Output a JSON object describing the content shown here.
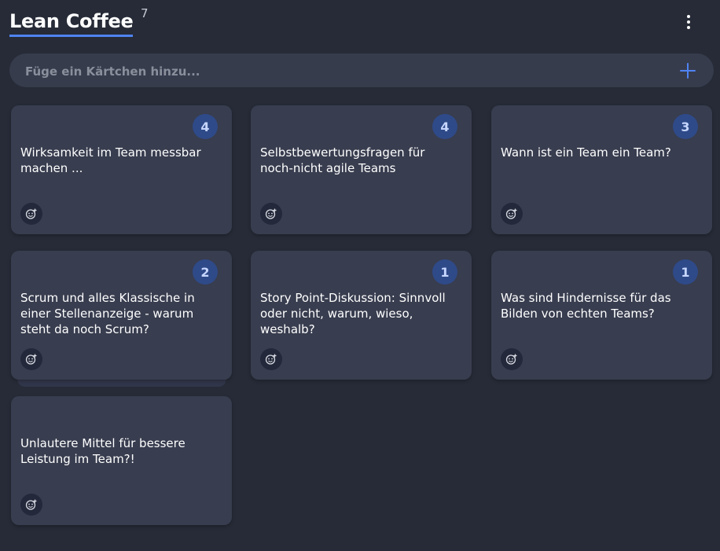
{
  "header": {
    "title": "Lean Coffee",
    "count": "7",
    "menu_icon": "more-vertical-icon"
  },
  "add_bar": {
    "placeholder": "Füge ein Kärtchen hinzu...",
    "value": "",
    "add_icon": "plus-icon",
    "accent": "#4f83f2"
  },
  "cards": [
    {
      "text": "Wirksamkeit im Team messbar machen ...",
      "votes": "4"
    },
    {
      "text": "Selbstbewertungsfragen für noch-nicht agile Teams",
      "votes": "4"
    },
    {
      "text": "Wann ist ein Team ein Team?",
      "votes": "3"
    },
    {
      "text": "Scrum und alles Klassische in einer Stellenanzeige - warum steht da noch Scrum?",
      "votes": "2"
    },
    {
      "text": "Story Point-Diskussion: Sinnvoll oder nicht, warum, wieso, weshalb?",
      "votes": "1"
    },
    {
      "text": "Was sind Hindernisse für das Bilden von echten Teams?",
      "votes": "1"
    },
    {
      "text": "Unlautere Mittel für bessere Leistung im Team?!",
      "votes": ""
    }
  ],
  "colors": {
    "background": "#262b37",
    "card": "#383d4f",
    "badge": "#2f4a88",
    "badge_text": "#c6d6ff"
  }
}
